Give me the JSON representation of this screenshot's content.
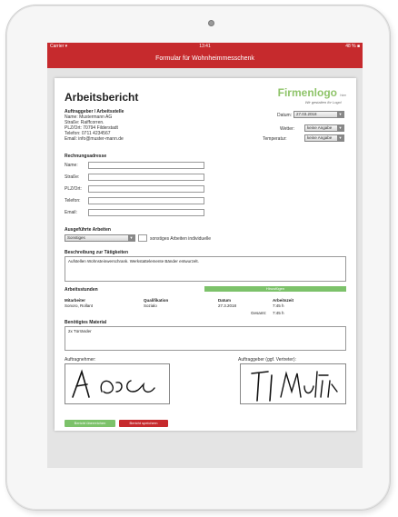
{
  "statusbar": {
    "left": "Carrier ▾",
    "center": "13:41",
    "right": "48 % ■"
  },
  "navbar": {
    "title": "Formular für Wohnheimmesschenk"
  },
  "report": {
    "title": "Arbeitsbericht",
    "logo": "Firmenlogo",
    "logo_suffix": "hier",
    "slogan": "Wir gestalten Ihr Logo!",
    "contractor": {
      "heading": "Auftraggeber / Arbeitsstelle",
      "lines": [
        "Name:   Mustermann AG",
        "Straße:   Raiffcorren.",
        "PLZ/Ort: 70794 Filderstadt",
        "Telefon: 0711 4234567",
        "Email:   info@muster-mann.de"
      ]
    },
    "datum_label": "Datum:",
    "datum_value": "27.03.2018",
    "wetter_label": "Wetter:",
    "wetter_value": "keine Angabe",
    "temperatur_label": "Temperatur:",
    "temperatur_value": "keine Angabe",
    "billing": {
      "heading": "Rechnungsadresse",
      "fields": [
        "Name:",
        "Straße:",
        "PLZ/Ort:",
        "Telefon:",
        "Email:"
      ]
    },
    "work": {
      "heading": "Ausgeführte Arbeiten",
      "select_value": "Sonstiges",
      "other_text": "sonstiges Arbeiten individuelle"
    },
    "description": {
      "heading": "Beschreibung zur Tätigkeiten",
      "text": "Aufstellen Wohnsteinwerschrank. Werkstattelemente Bänder entwurzelt."
    },
    "hours": {
      "heading": "Arbeitsstunden",
      "button": "Hinzufügen",
      "col1": "Mitarbeiter",
      "col2": "Qualifikation",
      "col3": "Datum",
      "col4": "Arbeitszeit",
      "name": "Sonoro, Rollant",
      "qualification": "Sozialo",
      "date": "27.3.2018",
      "time": "7:45 h",
      "total_label": "Gesamt:",
      "total_value": "7:45 h"
    },
    "material": {
      "heading": "Benötigtes Material",
      "text": "2x Türränder"
    },
    "signatures": {
      "left_label": "Auftragnehmer:",
      "right_label": "Auftraggeber (ggf. Vertreter):",
      "left_sig": "A. Bsl",
      "right_sig": "M. Mufk"
    },
    "buttons": {
      "send": "Bericht überreichen",
      "delete": "Bericht speichern"
    }
  },
  "colors": {
    "brand_red": "#c62a2d",
    "accent_green": "#7cc26a"
  }
}
